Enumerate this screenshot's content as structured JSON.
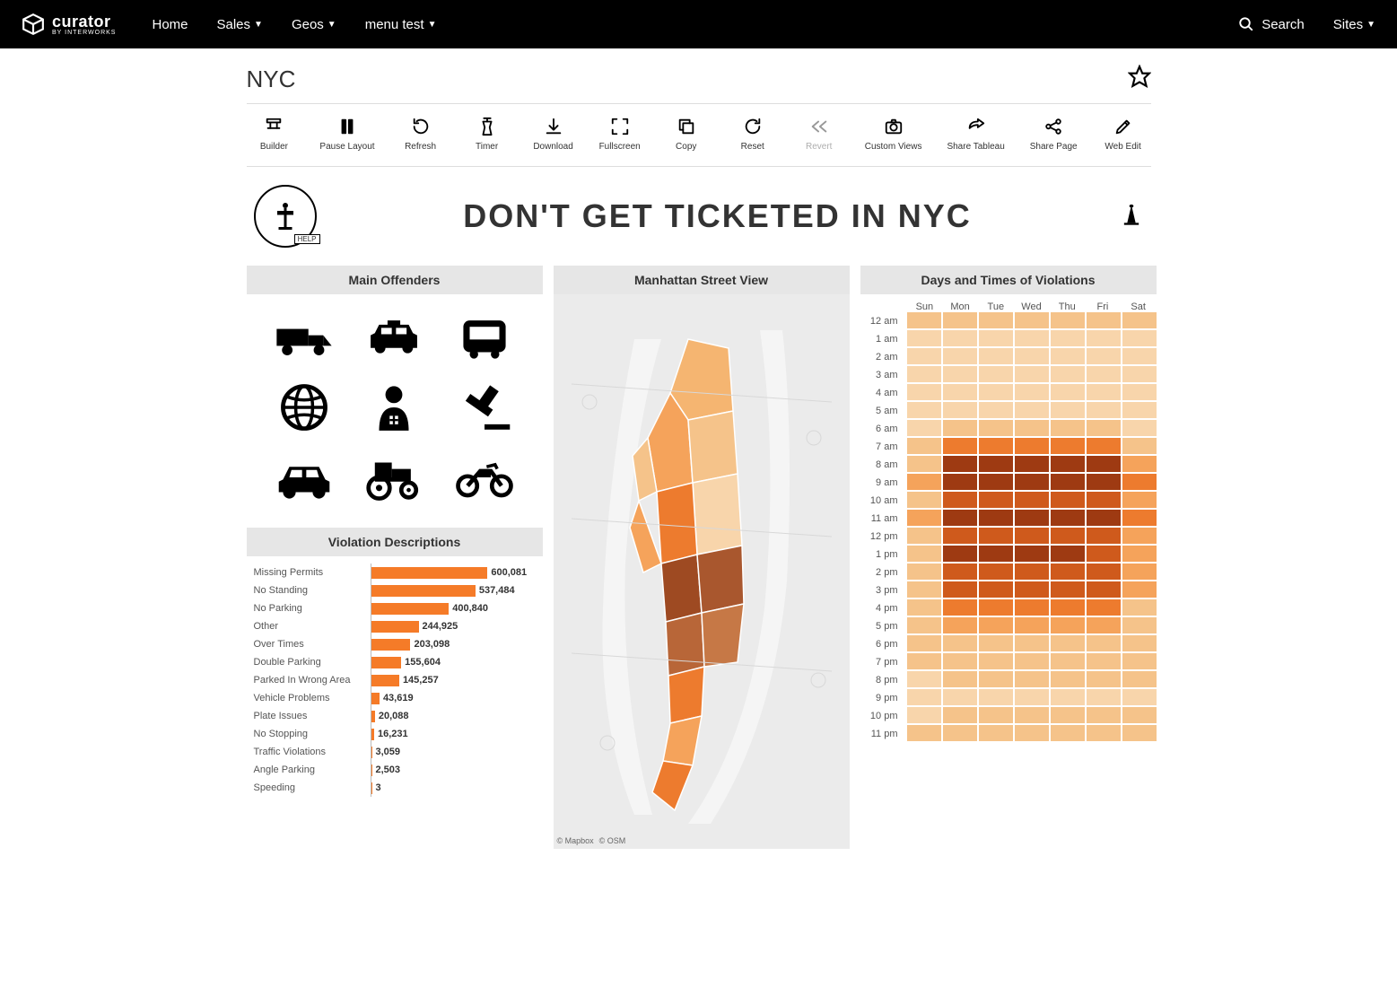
{
  "nav": {
    "brand": "curator",
    "brand_sub": "BY INTERWORKS",
    "links": [
      "Home",
      "Sales",
      "Geos",
      "menu test"
    ],
    "link_has_caret": [
      false,
      true,
      true,
      true
    ],
    "search_label": "Search",
    "sites_label": "Sites"
  },
  "page": {
    "title": "NYC"
  },
  "toolbar": [
    {
      "label": "Builder",
      "icon": "builder"
    },
    {
      "label": "Pause Layout",
      "icon": "pause"
    },
    {
      "label": "Refresh",
      "icon": "refresh"
    },
    {
      "label": "Timer",
      "icon": "timer"
    },
    {
      "label": "Download",
      "icon": "download"
    },
    {
      "label": "Fullscreen",
      "icon": "fullscreen"
    },
    {
      "label": "Copy",
      "icon": "copy"
    },
    {
      "label": "Reset",
      "icon": "reset"
    },
    {
      "label": "Revert",
      "icon": "revert",
      "disabled": true
    },
    {
      "label": "Custom Views",
      "icon": "camera"
    },
    {
      "label": "Share Tableau",
      "icon": "share"
    },
    {
      "label": "Share Page",
      "icon": "share2"
    },
    {
      "label": "Web Edit",
      "icon": "edit"
    }
  ],
  "dashboard": {
    "help_label": "HELP",
    "title": "DON'T GET TICKETED IN NYC",
    "panels": {
      "offenders": "Main Offenders",
      "violations": "Violation Descriptions",
      "map": "Manhattan Street View",
      "heatmap": "Days and Times of Violations"
    },
    "offender_icons": [
      "truck",
      "taxi",
      "bus",
      "globe",
      "officer",
      "gavel",
      "car",
      "tractor",
      "motorcycle"
    ],
    "map_attrib": [
      "© Mapbox",
      "© OSM"
    ]
  },
  "chart_data": {
    "violations": {
      "type": "bar",
      "orientation": "horizontal",
      "xlabel": "",
      "ylabel": "",
      "max": 600081,
      "categories": [
        "Missing Permits",
        "No Standing",
        "No Parking",
        "Other",
        "Over Times",
        "Double Parking",
        "Parked In Wrong Area",
        "Vehicle Problems",
        "Plate Issues",
        "No Stopping",
        "Traffic Violations",
        "Angle Parking",
        "Speeding"
      ],
      "values": [
        600081,
        537484,
        400840,
        244925,
        203098,
        155604,
        145257,
        43619,
        20088,
        16231,
        3059,
        2503,
        3
      ],
      "labels": [
        "600,081",
        "537,484",
        "400,840",
        "244,925",
        "203,098",
        "155,604",
        "145,257",
        "43,619",
        "20,088",
        "16,231",
        "3,059",
        "2,503",
        "3"
      ],
      "color": "#f57b28"
    },
    "heatmap": {
      "type": "heatmap",
      "title": "Days and Times of Violations",
      "days": [
        "Sun",
        "Mon",
        "Tue",
        "Wed",
        "Thu",
        "Fri",
        "Sat"
      ],
      "hours": [
        "12 am",
        "1 am",
        "2 am",
        "3 am",
        "4 am",
        "5 am",
        "6 am",
        "7 am",
        "8 am",
        "9 am",
        "10 am",
        "11 am",
        "12 pm",
        "1 pm",
        "2 pm",
        "3 pm",
        "4 pm",
        "5 pm",
        "6 pm",
        "7 pm",
        "8 pm",
        "9 pm",
        "10 pm",
        "11 pm"
      ],
      "intensity_scale": "0=lowest,5=highest",
      "values": [
        [
          1,
          1,
          1,
          1,
          1,
          1,
          1
        ],
        [
          0,
          0,
          0,
          0,
          0,
          0,
          0
        ],
        [
          0,
          0,
          0,
          0,
          0,
          0,
          0
        ],
        [
          0,
          0,
          0,
          0,
          0,
          0,
          0
        ],
        [
          0,
          0,
          0,
          0,
          0,
          0,
          0
        ],
        [
          0,
          0,
          0,
          0,
          0,
          0,
          0
        ],
        [
          0,
          1,
          1,
          1,
          1,
          1,
          0
        ],
        [
          1,
          3,
          3,
          3,
          3,
          3,
          1
        ],
        [
          1,
          5,
          5,
          5,
          5,
          5,
          2
        ],
        [
          2,
          5,
          5,
          5,
          5,
          5,
          3
        ],
        [
          1,
          4,
          4,
          4,
          4,
          4,
          2
        ],
        [
          2,
          5,
          5,
          5,
          5,
          5,
          3
        ],
        [
          1,
          4,
          4,
          4,
          4,
          4,
          2
        ],
        [
          1,
          5,
          5,
          5,
          5,
          4,
          2
        ],
        [
          1,
          4,
          4,
          4,
          4,
          4,
          2
        ],
        [
          1,
          4,
          4,
          4,
          4,
          4,
          2
        ],
        [
          1,
          3,
          3,
          3,
          3,
          3,
          1
        ],
        [
          1,
          2,
          2,
          2,
          2,
          2,
          1
        ],
        [
          1,
          1,
          1,
          1,
          1,
          1,
          1
        ],
        [
          1,
          1,
          1,
          1,
          1,
          1,
          1
        ],
        [
          0,
          1,
          1,
          1,
          1,
          1,
          1
        ],
        [
          0,
          0,
          0,
          0,
          0,
          0,
          0
        ],
        [
          0,
          1,
          1,
          1,
          1,
          1,
          1
        ],
        [
          1,
          1,
          1,
          1,
          1,
          1,
          1
        ]
      ],
      "color_ramp": [
        "#f8d5ab",
        "#f5c38a",
        "#f5a35b",
        "#ed7b2e",
        "#cf5a1c",
        "#9e3a12"
      ]
    }
  }
}
